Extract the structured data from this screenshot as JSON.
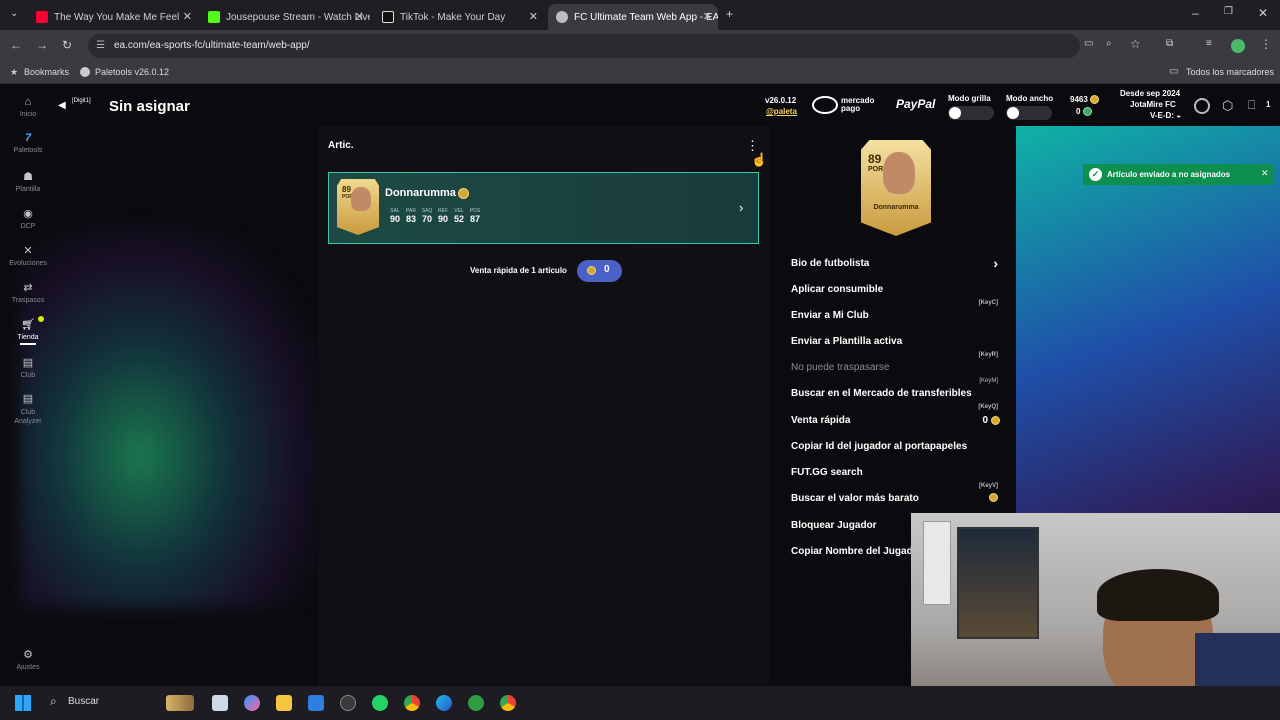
{
  "browser": {
    "tabs": [
      {
        "title": "The Way You Make Me Feel",
        "favicon_color": "#ff0033"
      },
      {
        "title": "Jousepouse Stream - Watch Live",
        "favicon_color": "#53fc18"
      },
      {
        "title": "TikTok - Make Your Day",
        "favicon_color": "#ffffff"
      },
      {
        "title": "FC Ultimate Team Web App - EA",
        "favicon_color": "#bcbcc4"
      }
    ],
    "url": "ea.com/ea-sports-fc/ultimate-team/web-app/",
    "bookmarks": [
      "Bookmarks",
      "Paletools v26.0.12"
    ],
    "all_bookmarks": "Todos los marcadores"
  },
  "sidebar": {
    "items": [
      {
        "label": "Inicio",
        "icon": "home-icon"
      },
      {
        "label": "Paletools",
        "icon": "paletools-icon"
      },
      {
        "label": "Plantilla",
        "icon": "squad-icon"
      },
      {
        "label": "DCP",
        "icon": "sbc-icon"
      },
      {
        "label": "Evoluciones",
        "icon": "evolutions-icon"
      },
      {
        "label": "Traspasos",
        "icon": "transfers-icon"
      },
      {
        "label": "Tienda",
        "icon": "store-icon"
      },
      {
        "label": "Club",
        "icon": "club-icon"
      },
      {
        "label": "Club Analyzer",
        "icon": "club-analyzer-icon"
      }
    ],
    "settings_label": "Ajustes"
  },
  "header": {
    "back_tag": "[Digit1]",
    "title": "Sin asignar",
    "version": "v26.0.12",
    "handle": "@paleta",
    "mercado_pago": "mercado pago",
    "paypal": "PayPal",
    "grid_mode": "Modo grilla",
    "wide_mode": "Modo ancho",
    "coins": "9463",
    "points": "0",
    "since": "Desde sep 2024",
    "club_name": "JotaMire FC",
    "record": "V-E-D:",
    "notifications": "1"
  },
  "items_panel": {
    "heading": "Artic.",
    "player": {
      "name": "Donnarumma",
      "rating": "89",
      "position": "POR",
      "stat_labels": [
        "SAL",
        "PAR",
        "SAQ",
        "REF",
        "VEL",
        "POS"
      ],
      "stat_values": [
        "90",
        "83",
        "70",
        "90",
        "52",
        "87"
      ]
    },
    "quick_sell_label": "Venta rápida de 1 artículo",
    "quick_sell_value": "0"
  },
  "detail_panel": {
    "card_name": "Donnarumma",
    "card_rating": "89",
    "card_position": "POR",
    "menu": [
      {
        "label": "Bio de futbolista",
        "key": "",
        "disabled": false
      },
      {
        "label": "Aplicar consumible",
        "key": "[KeyC]",
        "disabled": false
      },
      {
        "label": "Enviar a Mi Club",
        "key": "",
        "disabled": false
      },
      {
        "label": "Enviar a Plantilla activa",
        "key": "[KeyR]",
        "disabled": false
      },
      {
        "label": "No puede traspasarse",
        "key": "[KeyM]",
        "disabled": true
      },
      {
        "label": "Buscar en el Mercado de transferibles",
        "key": "[KeyQ]",
        "disabled": false
      },
      {
        "label": "Venta rápida",
        "key": "",
        "disabled": false
      },
      {
        "label": "Copiar Id del jugador al portapapeles",
        "key": "",
        "disabled": false
      },
      {
        "label": "FUT.GG search",
        "key": "[KeyV]",
        "disabled": false
      },
      {
        "label": "Buscar el valor más barato",
        "key": "",
        "disabled": false
      },
      {
        "label": "Bloquear Jugador",
        "key": "",
        "disabled": false
      },
      {
        "label": "Copiar Nombre del Jugador",
        "key": "",
        "disabled": false
      }
    ],
    "quick_sell_price": "0"
  },
  "toast": {
    "message": "Artículo enviado a no asignados"
  },
  "taskbar": {
    "search_placeholder": "Buscar"
  },
  "colors": {
    "accent": "#46c2a8",
    "toast": "#0d8f4e",
    "gold": "#d6a933"
  }
}
